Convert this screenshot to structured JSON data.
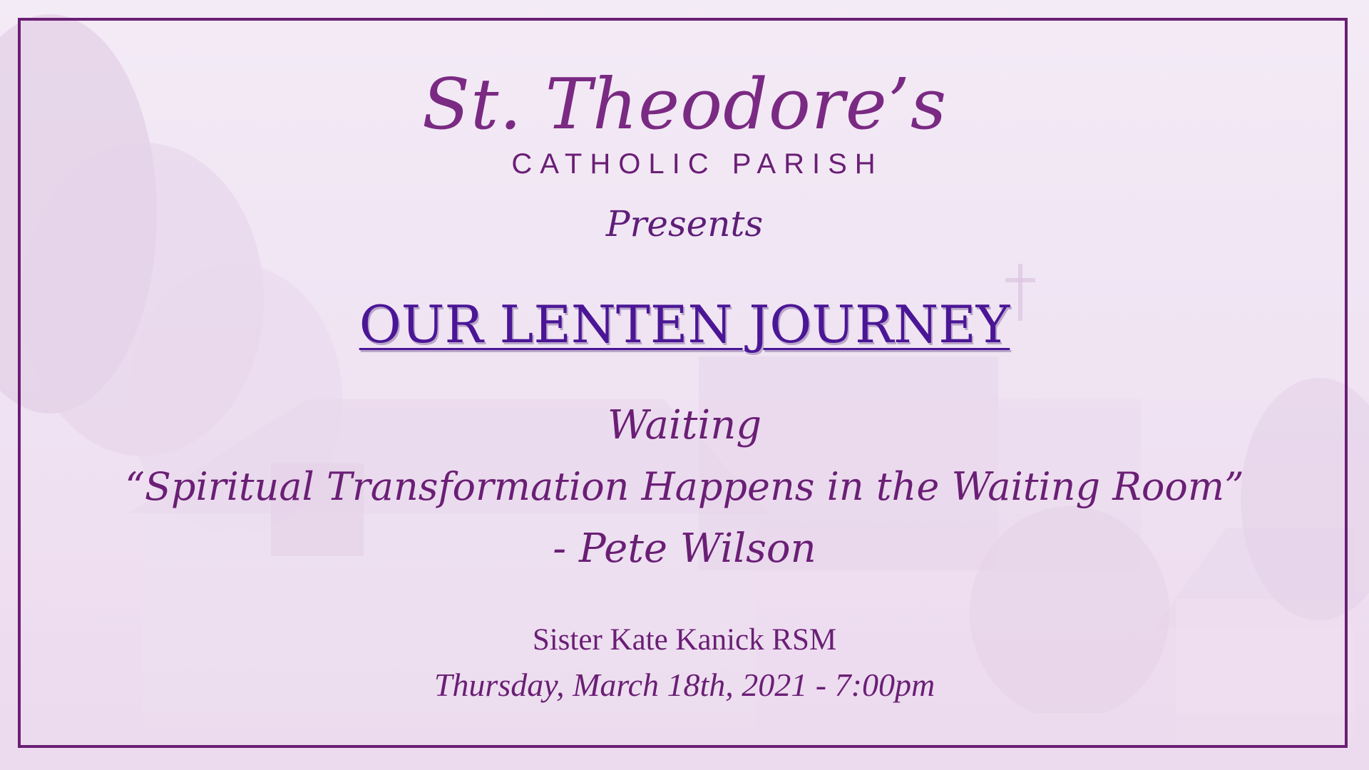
{
  "colors": {
    "primary": "#6a1f75",
    "headline": "#4b1696",
    "background": "#f1e6f4"
  },
  "logo": {
    "script": "St. Theodore’s",
    "subtitle": "CATHOLIC PARISH"
  },
  "presents": "Presents",
  "headline": "OUR LENTEN JOURNEY",
  "topic": {
    "title": "Waiting",
    "quote": "“Spiritual Transformation Happens in the Waiting Room”",
    "author": "- Pete Wilson"
  },
  "event": {
    "speaker": "Sister Kate Kanick RSM",
    "datetime": "Thursday, March 18th, 2021 - 7:00pm"
  }
}
